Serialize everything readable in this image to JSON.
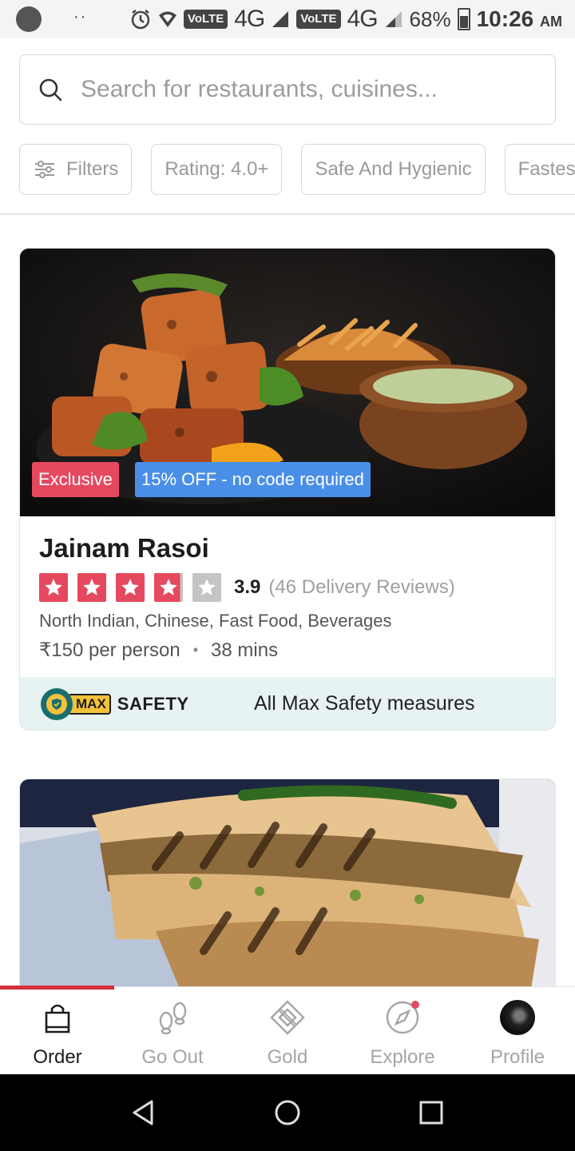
{
  "status_bar": {
    "network_1": "VoLTE",
    "net_type_1": "4G",
    "network_2": "VoLTE",
    "net_type_2": "4G",
    "battery": "68%",
    "time": "10:26",
    "time_suffix": "AM"
  },
  "search": {
    "placeholder": "Search for restaurants, cuisines..."
  },
  "filter_chips": [
    {
      "label": "Filters"
    },
    {
      "label": "Rating: 4.0+"
    },
    {
      "label": "Safe And Hygienic"
    },
    {
      "label": "Fastest Delivery"
    }
  ],
  "restaurant": {
    "badges": {
      "exclusive": "Exclusive",
      "offer": "15% OFF - no code required"
    },
    "name": "Jainam Rasoi",
    "rating": "3.9",
    "rating_value": 3.9,
    "reviews": "(46 Delivery Reviews)",
    "cuisines": "North Indian, Chinese, Fast Food, Beverages",
    "price": "₹150 per person",
    "delivery_time": "38 mins",
    "safety": {
      "logo_max": "MAX",
      "logo_word": "SAFETY",
      "text": "All Max Safety measures"
    }
  },
  "bottom_nav": [
    {
      "label": "Order",
      "icon": "shopping-bag-icon",
      "active": true
    },
    {
      "label": "Go Out",
      "icon": "footprints-icon",
      "active": false
    },
    {
      "label": "Gold",
      "icon": "gold-diamond-icon",
      "active": false
    },
    {
      "label": "Explore",
      "icon": "compass-icon",
      "active": false
    },
    {
      "label": "Profile",
      "icon": "avatar",
      "active": false
    }
  ],
  "colors": {
    "accent": "#d4303d",
    "exclusive_badge": "#e5495f",
    "offer_badge": "#4a8fe7",
    "star_filled": "#e5495f",
    "star_empty": "#c4c4c4",
    "safety_bg": "#e7f3f3"
  }
}
